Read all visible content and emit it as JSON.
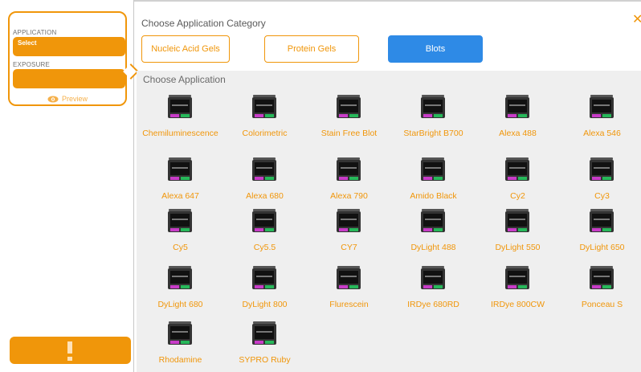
{
  "sidebar": {
    "application_label": "APPLICATION",
    "application_value": "Select",
    "exposure_label": "EXPOSURE",
    "exposure_value": "",
    "preview_label": "Preview",
    "alert_icon": "exclamation-icon"
  },
  "dialog": {
    "category_title": "Choose Application Category",
    "close_icon": "close-icon",
    "categories": [
      {
        "label": "Nucleic Acid Gels",
        "active": false
      },
      {
        "label": "Protein Gels",
        "active": false
      },
      {
        "label": "Blots",
        "active": true
      }
    ],
    "applications_title": "Choose Application",
    "applications": [
      "Chemiluminescence",
      "Colorimetric",
      "Stain Free Blot",
      "StarBright B700",
      "Alexa 488",
      "Alexa 546",
      "Alexa 647",
      "Alexa 680",
      "Alexa 790",
      "Amido Black",
      "Cy2",
      "Cy3",
      "Cy5",
      "Cy5.5",
      "CY7",
      "DyLight 488",
      "DyLight 550",
      "DyLight 650",
      "DyLight 680",
      "DyLight 800",
      "Flurescein",
      "IRDye 680RD",
      "IRDye 800CW",
      "Ponceau S",
      "Rhodamine",
      "SYPRO Ruby"
    ]
  },
  "colors": {
    "accent_orange": "#f0960a",
    "active_blue": "#2e8ae6",
    "icon_magenta": "#c83cc8",
    "icon_green": "#27b85a"
  }
}
